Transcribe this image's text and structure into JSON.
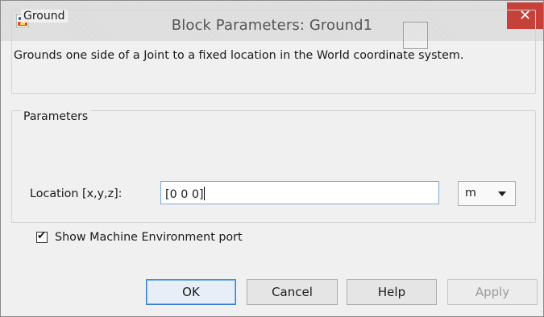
{
  "window": {
    "title": "Block Parameters: Ground1",
    "close_glyph": "✕",
    "colors": {
      "close_bg": "#c7413b",
      "focus_border": "#3c7fd1"
    }
  },
  "ground": {
    "legend": "Ground",
    "description": "Grounds one side of a Joint to a fixed location in the World coordinate system."
  },
  "parameters": {
    "legend": "Parameters",
    "location_label": "Location [x,y,z]:",
    "location_value": "[0 0 0]",
    "unit_value": "m",
    "show_port_label": "Show Machine Environment port",
    "show_port_checked": true,
    "check_glyph": "✔"
  },
  "buttons": {
    "ok": "OK",
    "cancel": "Cancel",
    "help": "Help",
    "apply": "Apply"
  }
}
